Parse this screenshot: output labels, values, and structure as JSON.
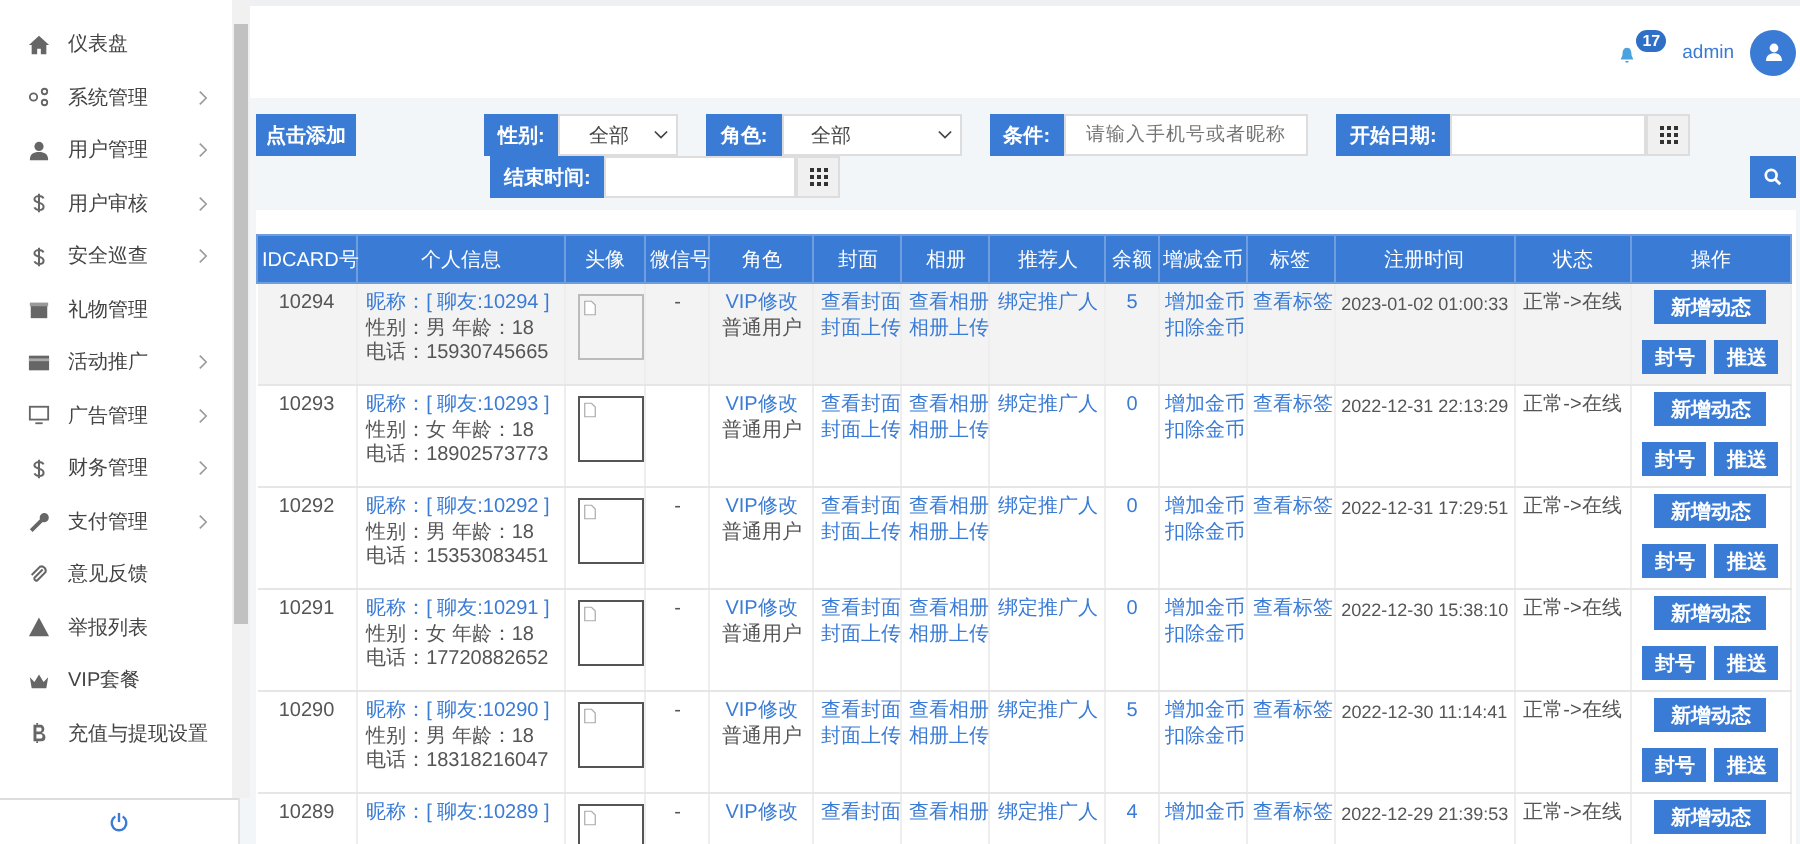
{
  "sidebar": {
    "items": [
      {
        "label": "仪表盘",
        "expandable": false
      },
      {
        "label": "系统管理",
        "expandable": true
      },
      {
        "label": "用户管理",
        "expandable": true
      },
      {
        "label": "用户审核",
        "expandable": true
      },
      {
        "label": "安全巡查",
        "expandable": true
      },
      {
        "label": "礼物管理",
        "expandable": false
      },
      {
        "label": "活动推广",
        "expandable": true
      },
      {
        "label": "广告管理",
        "expandable": true
      },
      {
        "label": "财务管理",
        "expandable": true
      },
      {
        "label": "支付管理",
        "expandable": true
      },
      {
        "label": "意见反馈",
        "expandable": false
      },
      {
        "label": "举报列表",
        "expandable": false
      },
      {
        "label": "VIP套餐",
        "expandable": false
      },
      {
        "label": "充值与提现设置",
        "expandable": false
      }
    ]
  },
  "header": {
    "notification_count": "17",
    "user": "admin"
  },
  "filters": {
    "add_button": "点击添加",
    "gender": {
      "label": "性别:",
      "value": "全部"
    },
    "role": {
      "label": "角色:",
      "value": "全部"
    },
    "condition": {
      "label": "条件:",
      "placeholder": "请输入手机号或者昵称"
    },
    "start_date": {
      "label": "开始日期:"
    },
    "end_date": {
      "label": "结束时间:"
    }
  },
  "table": {
    "columns": [
      "IDCARD号",
      "个人信息",
      "头像",
      "微信号",
      "角色",
      "封面",
      "相册",
      "推荐人",
      "余额",
      "增减金币",
      "标签",
      "注册时间",
      "状态",
      "操作"
    ],
    "rows": [
      {
        "selected": true,
        "id": "10294",
        "info": [
          "昵称：[ 聊友:10294 ]",
          "性别：男 年龄：18",
          "电话：15930745665"
        ],
        "wechat": "-",
        "role": [
          "VIP修改",
          "普通用户"
        ],
        "cover": [
          "查看封面",
          "封面上传"
        ],
        "album": [
          "查看相册",
          "相册上传"
        ],
        "referrer": "绑定推广人",
        "balance": "5",
        "coins": [
          "增加金币",
          "扣除金币"
        ],
        "tag": "查看标签",
        "registered": "2023-01-02 01:00:33",
        "status": "正常->在线",
        "actions": [
          "新增动态",
          "封号",
          "推送"
        ]
      },
      {
        "selected": false,
        "id": "10293",
        "info": [
          "昵称：[ 聊友:10293 ]",
          "性别：女 年龄：18",
          "电话：18902573773"
        ],
        "role": [
          "VIP修改",
          "普通用户"
        ],
        "cover": [
          "查看封面",
          "封面上传"
        ],
        "album": [
          "查看相册",
          "相册上传"
        ],
        "referrer": "绑定推广人",
        "balance": "0",
        "coins": [
          "增加金币",
          "扣除金币"
        ],
        "tag": "查看标签",
        "registered": "2022-12-31 22:13:29",
        "status": "正常->在线",
        "actions": [
          "新增动态",
          "封号",
          "推送"
        ]
      },
      {
        "selected": false,
        "id": "10292",
        "info": [
          "昵称：[ 聊友:10292 ]",
          "性别：男 年龄：18",
          "电话：15353083451"
        ],
        "wechat": "-",
        "role": [
          "VIP修改",
          "普通用户"
        ],
        "cover": [
          "查看封面",
          "封面上传"
        ],
        "album": [
          "查看相册",
          "相册上传"
        ],
        "referrer": "绑定推广人",
        "balance": "0",
        "coins": [
          "增加金币",
          "扣除金币"
        ],
        "tag": "查看标签",
        "registered": "2022-12-31 17:29:51",
        "status": "正常->在线",
        "actions": [
          "新增动态",
          "封号",
          "推送"
        ]
      },
      {
        "selected": false,
        "id": "10291",
        "info": [
          "昵称：[ 聊友:10291 ]",
          "性别：女 年龄：18",
          "电话：17720882652"
        ],
        "wechat": "-",
        "role": [
          "VIP修改",
          "普通用户"
        ],
        "cover": [
          "查看封面",
          "封面上传"
        ],
        "album": [
          "查看相册",
          "相册上传"
        ],
        "referrer": "绑定推广人",
        "balance": "0",
        "coins": [
          "增加金币",
          "扣除金币"
        ],
        "tag": "查看标签",
        "registered": "2022-12-30 15:38:10",
        "status": "正常->在线",
        "actions": [
          "新增动态",
          "封号",
          "推送"
        ]
      },
      {
        "selected": false,
        "id": "10290",
        "info": [
          "昵称：[ 聊友:10290 ]",
          "性别：男 年龄：18",
          "电话：18318216047"
        ],
        "wechat": "-",
        "role": [
          "VIP修改",
          "普通用户"
        ],
        "cover": [
          "查看封面",
          "封面上传"
        ],
        "album": [
          "查看相册",
          "相册上传"
        ],
        "referrer": "绑定推广人",
        "balance": "5",
        "coins": [
          "增加金币",
          "扣除金币"
        ],
        "tag": "查看标签",
        "registered": "2022-12-30 11:14:41",
        "status": "正常->在线",
        "actions": [
          "新增动态",
          "封号",
          "推送"
        ]
      },
      {
        "selected": false,
        "id": "10289",
        "info": [
          "昵称：[ 聊友:10289 ]"
        ],
        "wechat": "-",
        "role": [
          "VIP修改"
        ],
        "cover": [
          "查看封面"
        ],
        "album": [
          "查看相册"
        ],
        "referrer": "绑定推广人",
        "balance": "4",
        "coins": [
          "增加金币"
        ],
        "tag": "查看标签",
        "registered": "2022-12-29 21:39:53",
        "status": "正常->在线",
        "actions": [
          "新增动态"
        ]
      }
    ]
  }
}
